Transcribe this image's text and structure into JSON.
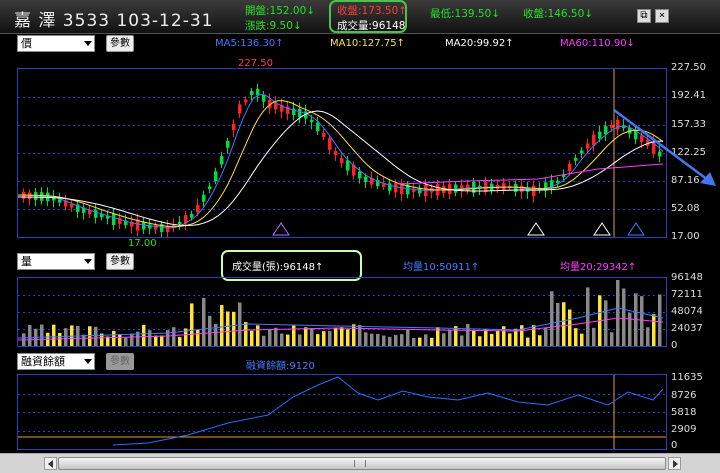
{
  "header": {
    "stock_title": "嘉  澤  3533  103-12-31",
    "open": "開盤:152.00↓",
    "change": "漲跌:9.50↓",
    "close_price": "收盤:173.50↑",
    "volume": "成交量:96148",
    "low": "最低:139.50↓",
    "settle": "收盤:146.50↓"
  },
  "price_panel": {
    "select_value": "價",
    "param_button": "參數",
    "ma5": "MA5:136.30↑",
    "ma10": "MA10:127.75↑",
    "ma20": "MA20:99.92↑",
    "ma60": "MA60:110.90↓",
    "high_label": "227.50",
    "low_label": "17.00",
    "y_ticks": [
      "227.50",
      "192.41",
      "157.33",
      "122.25",
      "87.16",
      "52.08",
      "17.00"
    ],
    "markers": [
      "60",
      "20",
      "10",
      "5"
    ]
  },
  "volume_panel": {
    "select_value": "量",
    "param_button": "參數",
    "volume_label": "成交量(張):96148↑",
    "vol10": "均量10:50911↑",
    "vol20": "均量20:29342↑",
    "y_ticks": [
      "96148",
      "72111",
      "48074",
      "24037",
      "0"
    ]
  },
  "margin_panel": {
    "select_value": "融資餘額",
    "param_button": "參數",
    "balance_label": "融資餘額:9120",
    "y_ticks": [
      "11635",
      "8726",
      "5818",
      "2909",
      "0"
    ]
  },
  "colors": {
    "up": "#ff2222",
    "down": "#00dd44",
    "ma5": "#3f7cff",
    "ma10": "#ffe23a",
    "ma20": "#ffffff",
    "ma60": "#ff3cff",
    "grid": "#2a3fbf"
  },
  "icons": [
    "restore-icon",
    "close-icon",
    "trend-arrow-icon"
  ]
}
